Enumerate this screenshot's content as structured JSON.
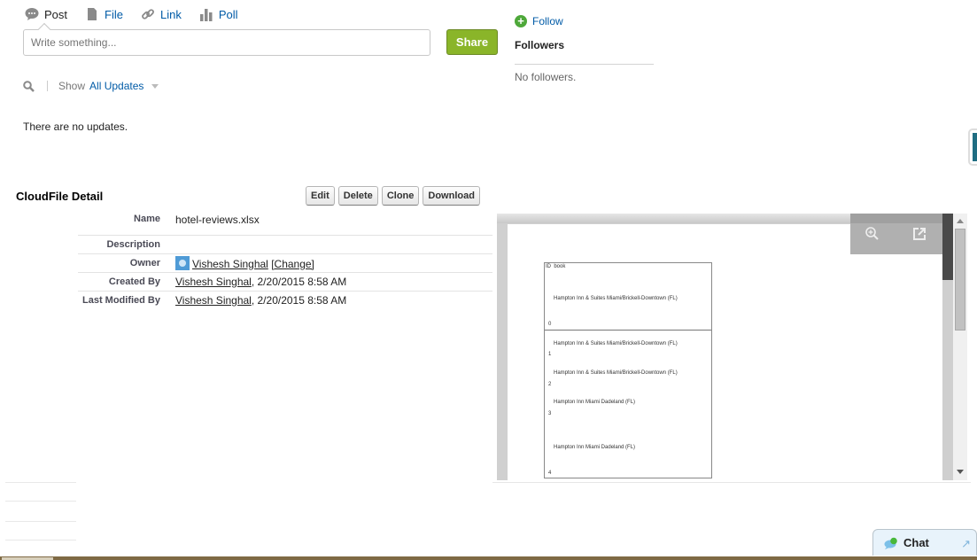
{
  "publisher": {
    "tabs": [
      {
        "label": "Post",
        "icon": "speech-bubble-icon",
        "active": true
      },
      {
        "label": "File",
        "icon": "file-icon",
        "active": false
      },
      {
        "label": "Link",
        "icon": "link-icon",
        "active": false
      },
      {
        "label": "Poll",
        "icon": "poll-icon",
        "active": false
      }
    ],
    "input_placeholder": "Write something...",
    "share_label": "Share",
    "share_color": "#8ab529"
  },
  "feed": {
    "show_label": "Show",
    "filter_value": "All Updates",
    "empty_text": "There are no updates."
  },
  "followers": {
    "follow_label": "Follow",
    "title": "Followers",
    "empty_text": "No followers."
  },
  "detail": {
    "title": "CloudFile Detail",
    "buttons": [
      "Edit",
      "Delete",
      "Clone",
      "Download"
    ],
    "fields": {
      "name": {
        "label": "Name",
        "value": "hotel-reviews.xlsx"
      },
      "description": {
        "label": "Description",
        "value": ""
      },
      "owner": {
        "label": "Owner",
        "user": "Vishesh Singhal",
        "change_link": "[Change]"
      },
      "created_by": {
        "label": "Created By",
        "user": "Vishesh Singhal",
        "timestamp": ", 2/20/2015 8:58 AM"
      },
      "last_modified_by": {
        "label": "Last Modified By",
        "user": "Vishesh Singhal",
        "timestamp": ", 2/20/2015 8:58 AM"
      }
    }
  },
  "preview": {
    "tools": [
      "zoom-in-icon",
      "open-external-icon"
    ],
    "sheet": {
      "headers": [
        "ID",
        "book"
      ],
      "rows": [
        {
          "id": "0",
          "book": "Hampton Inn & Suites Miami/Brickell-Downtown (FL)"
        },
        {
          "id": "1",
          "book": "Hampton Inn & Suites Miami/Brickell-Downtown (FL)"
        },
        {
          "id": "2",
          "book": "Hampton Inn & Suites Miami/Brickell-Downtown (FL)"
        },
        {
          "id": "3",
          "book": "Hampton Inn Miami Dadeland (FL)"
        },
        {
          "id": "4",
          "book": "Hampton Inn Miami Dadeland (FL)"
        }
      ]
    }
  },
  "chat": {
    "label": "Chat"
  }
}
